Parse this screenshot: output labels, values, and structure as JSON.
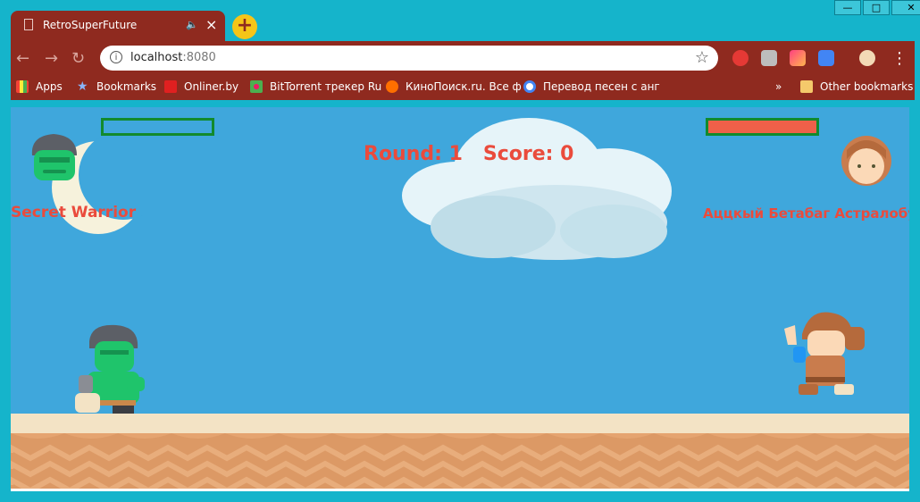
{
  "browser": {
    "tab_title": "RetroSuperFuture",
    "address_host": "localhost",
    "address_port": ":8080",
    "window_controls": [
      "minimize",
      "maximize",
      "close"
    ]
  },
  "bookmarks": [
    {
      "label": "Apps",
      "icon": "apps-grid-icon"
    },
    {
      "label": "Bookmarks",
      "icon": "star-icon"
    },
    {
      "label": "Onliner.by",
      "icon": "onliner-icon"
    },
    {
      "label": "BitTorrent трекер Ru",
      "icon": "bittorrent-icon"
    },
    {
      "label": "КиноПоиск.ru. Все ф",
      "icon": "kinopoisk-icon"
    },
    {
      "label": "Перевод песен с анг",
      "icon": "translate-icon"
    },
    {
      "label": "Other bookmarks",
      "icon": "folder-icon"
    }
  ],
  "game": {
    "round_label": "Round:",
    "round": "1",
    "score_label": "Score:",
    "score": "0",
    "player": {
      "name": "Secret Warrior",
      "health_fraction": 0.0
    },
    "enemy": {
      "name": "Аццкый Бетабаг Астралобур",
      "health_fraction": 1.0
    },
    "colors": {
      "sky": "#3fa7dc",
      "hud_text": "#ea4b3c",
      "hp_border": "#128a2d",
      "hp_fill": "#f06049",
      "ground": "#dc9965"
    }
  }
}
